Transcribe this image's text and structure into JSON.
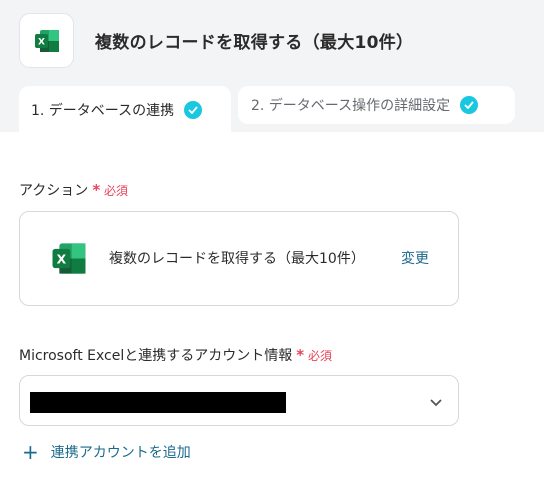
{
  "header": {
    "title": "複数のレコードを取得する（最大10件）",
    "app_icon": "excel-icon"
  },
  "tabs": [
    {
      "label": "1. データベースの連携",
      "completed": true
    },
    {
      "label": "2. データベース操作の詳細設定",
      "completed": true
    }
  ],
  "action_section": {
    "label": "アクション",
    "required_text": "必須",
    "selected_action": "複数のレコードを取得する（最大10件）",
    "change_label": "変更"
  },
  "account_section": {
    "label": "Microsoft Excelと連携するアカウント情報",
    "required_text": "必須",
    "add_account_label": "連携アカウントを追加"
  },
  "colors": {
    "check": "#1ac7e0",
    "required": "#e8445a",
    "link": "#1a6a8c",
    "excel_green": "#107c41"
  }
}
